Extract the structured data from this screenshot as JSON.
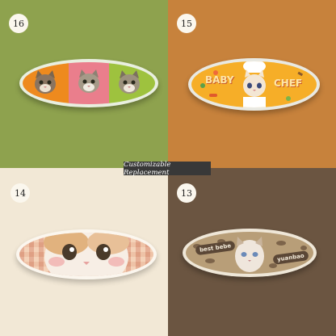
{
  "banner": "Customizable Replacement",
  "panels": [
    {
      "number": "16"
    },
    {
      "number": "15",
      "texts": [
        "BABY",
        "CHEF"
      ]
    },
    {
      "number": "14"
    },
    {
      "number": "13",
      "texts": [
        "best bebe",
        "yuanbao"
      ]
    }
  ],
  "colors": {
    "olive": "#8ea24e",
    "caramel": "#c7823c",
    "cream": "#f2e8d6",
    "brown": "#6b5541",
    "banner_bg": "#383838"
  }
}
